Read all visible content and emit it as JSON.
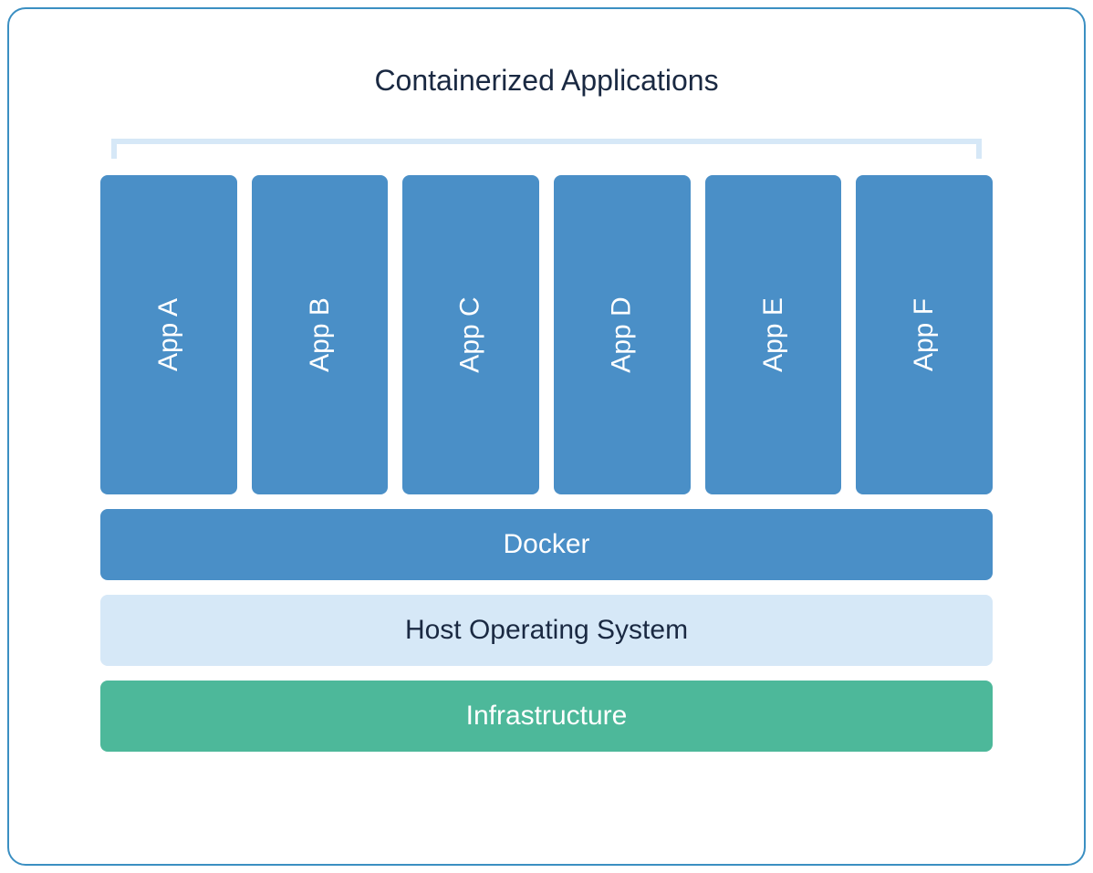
{
  "title": "Containerized Applications",
  "apps": [
    {
      "label": "App A"
    },
    {
      "label": "App B"
    },
    {
      "label": "App C"
    },
    {
      "label": "App D"
    },
    {
      "label": "App E"
    },
    {
      "label": "App F"
    }
  ],
  "layers": {
    "docker": "Docker",
    "host": "Host Operating System",
    "infrastructure": "Infrastructure"
  },
  "colors": {
    "border": "#3b8fc2",
    "app_bg": "#4a8fc7",
    "docker_bg": "#4a8fc7",
    "host_bg": "#d6e8f7",
    "infra_bg": "#4db89a",
    "title_text": "#1a2942",
    "light_text": "#ffffff"
  }
}
